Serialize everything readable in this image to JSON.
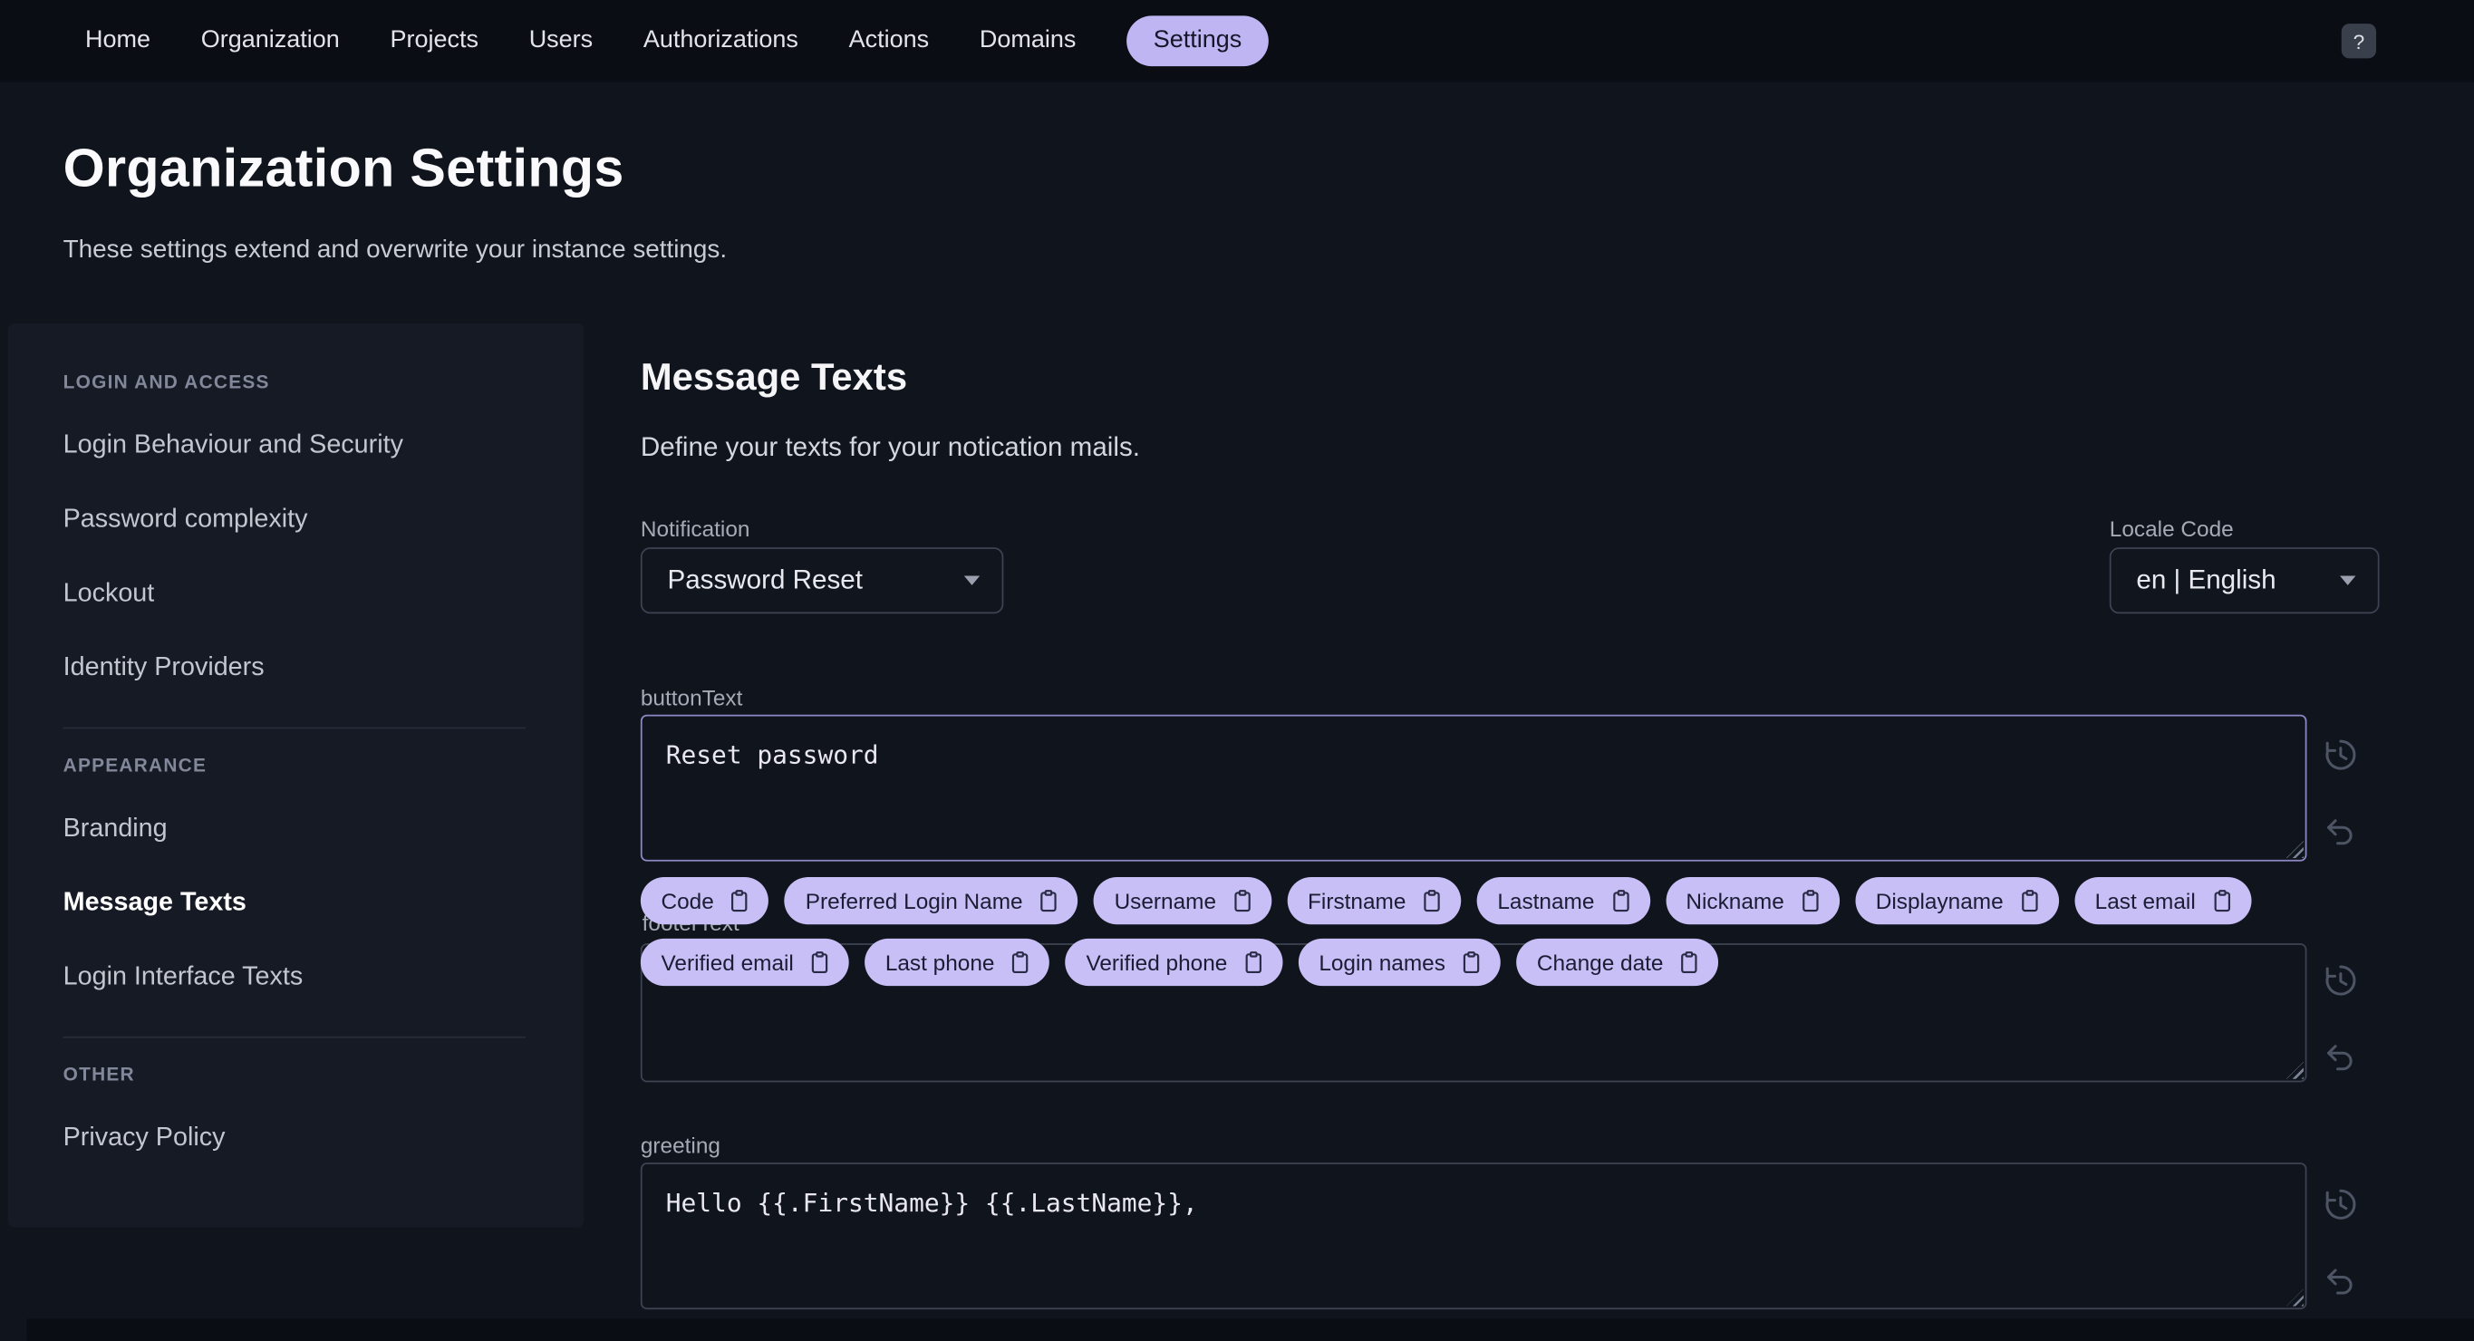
{
  "nav": {
    "items": [
      {
        "label": "Home"
      },
      {
        "label": "Organization"
      },
      {
        "label": "Projects"
      },
      {
        "label": "Users"
      },
      {
        "label": "Authorizations"
      },
      {
        "label": "Actions"
      },
      {
        "label": "Domains"
      },
      {
        "label": "Settings"
      }
    ],
    "help_label": "?"
  },
  "page": {
    "title": "Organization Settings",
    "subtitle": "These settings extend and overwrite your instance settings."
  },
  "sidebar": {
    "sections": [
      {
        "title": "LOGIN AND ACCESS",
        "items": [
          {
            "label": "Login Behaviour and Security"
          },
          {
            "label": "Password complexity"
          },
          {
            "label": "Lockout"
          },
          {
            "label": "Identity Providers"
          }
        ]
      },
      {
        "title": "APPEARANCE",
        "items": [
          {
            "label": "Branding"
          },
          {
            "label": "Message Texts"
          },
          {
            "label": "Login Interface Texts"
          }
        ]
      },
      {
        "title": "OTHER",
        "items": [
          {
            "label": "Privacy Policy"
          }
        ]
      }
    ]
  },
  "main": {
    "heading": "Message Texts",
    "description": "Define your texts for your notication mails.",
    "notification": {
      "label": "Notification",
      "value": "Password Reset"
    },
    "locale": {
      "label": "Locale Code",
      "value": "en | English"
    },
    "fields": {
      "button_text": {
        "label": "buttonText",
        "value": "Reset password"
      },
      "footer_text": {
        "label": "footerText",
        "value": ""
      },
      "greeting": {
        "label": "greeting",
        "value": "Hello {{.FirstName}} {{.LastName}},"
      }
    },
    "chips": [
      {
        "label": "Code"
      },
      {
        "label": "Preferred Login Name"
      },
      {
        "label": "Username"
      },
      {
        "label": "Firstname"
      },
      {
        "label": "Lastname"
      },
      {
        "label": "Nickname"
      },
      {
        "label": "Displayname"
      },
      {
        "label": "Last email"
      },
      {
        "label": "Verified email"
      },
      {
        "label": "Last phone"
      },
      {
        "label": "Verified phone"
      },
      {
        "label": "Login names"
      },
      {
        "label": "Change date"
      }
    ]
  },
  "colors": {
    "accent": "#c7bff5",
    "accent_text": "#1c1d35",
    "background": "#10141d"
  }
}
